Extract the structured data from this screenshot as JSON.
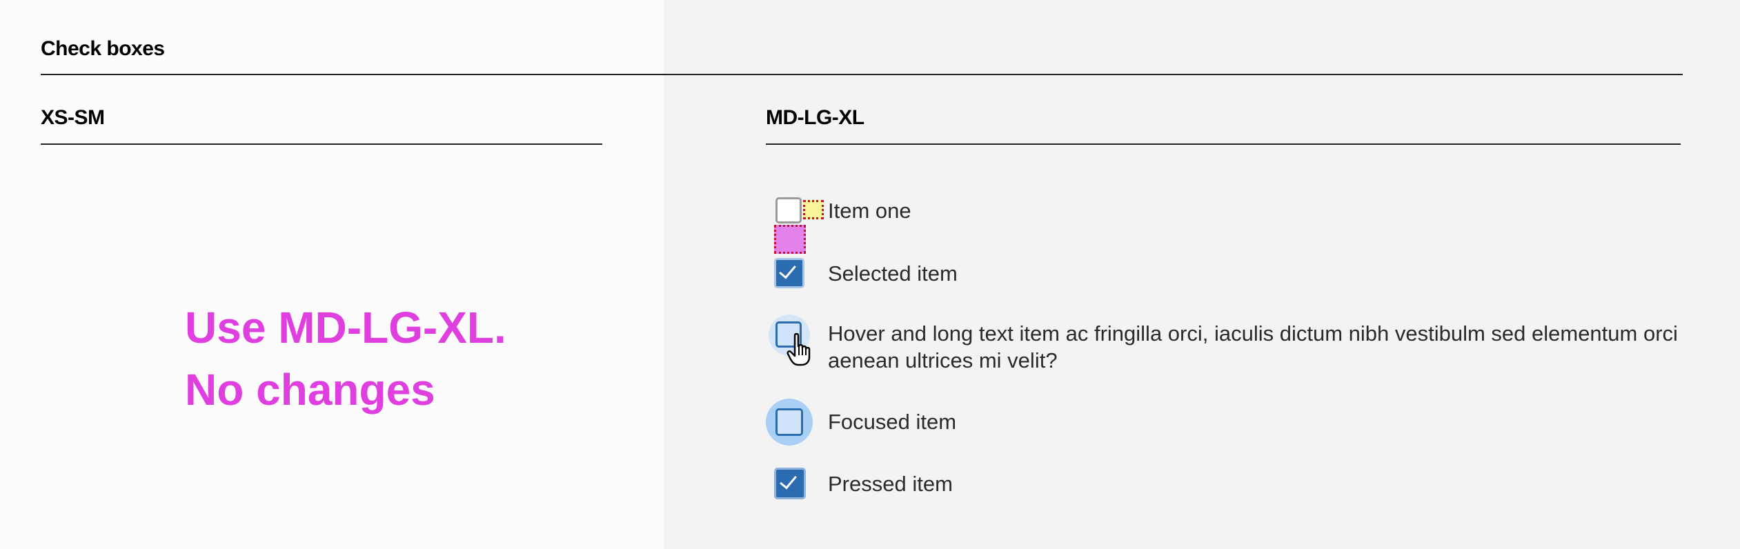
{
  "page_title": "Check boxes",
  "columns": {
    "small": {
      "title": "XS-SM"
    },
    "large": {
      "title": "MD-LG-XL"
    }
  },
  "note": {
    "line1": "Use MD-LG-XL.",
    "line2": "No changes"
  },
  "checkboxes": [
    {
      "label": "Item one",
      "state": "unchecked"
    },
    {
      "label": "Selected item",
      "state": "checked"
    },
    {
      "label": "Hover and long text item ac fringilla orci, iaculis dictum nibh vestibulm sed elementum orci aenean ultrices mi velit?",
      "state": "hover"
    },
    {
      "label": "Focused item",
      "state": "focused"
    },
    {
      "label": "Pressed item",
      "state": "pressed"
    }
  ],
  "colors": {
    "accent": "#2b6cb0",
    "annotation": "#e03fe0",
    "focus_halo": "#a9cff5",
    "right_panel_bg": "#f3f3f3"
  },
  "icons": {
    "check": "check-icon",
    "cursor": "hand-pointer-icon"
  }
}
